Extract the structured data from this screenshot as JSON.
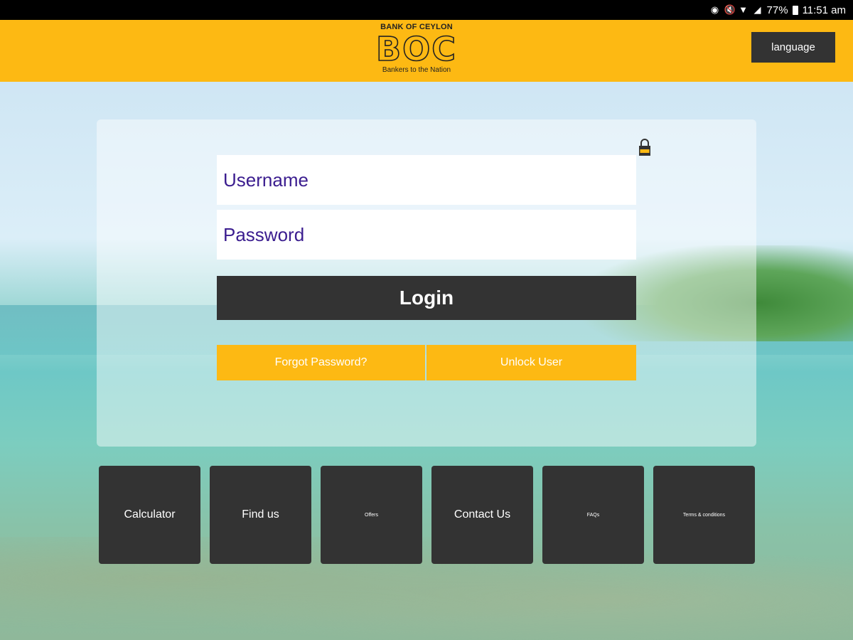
{
  "status_bar": {
    "battery": "77%",
    "time": "11:51 am"
  },
  "header": {
    "logo": {
      "top_text": "BANK OF CEYLON",
      "mark": "BOC",
      "tagline": "Bankers to the Nation"
    },
    "language_button": "language",
    "brand_color": "#fdb913"
  },
  "login": {
    "username_placeholder": "Username",
    "password_placeholder": "Password",
    "login_button": "Login",
    "forgot_password": "Forgot Password?",
    "unlock_user": "Unlock User"
  },
  "tiles": [
    {
      "label": "Calculator"
    },
    {
      "label": "Find us"
    },
    {
      "label": "Offers"
    },
    {
      "label": "Contact Us"
    },
    {
      "label": "FAQs"
    },
    {
      "label": "Terms & conditions"
    }
  ]
}
